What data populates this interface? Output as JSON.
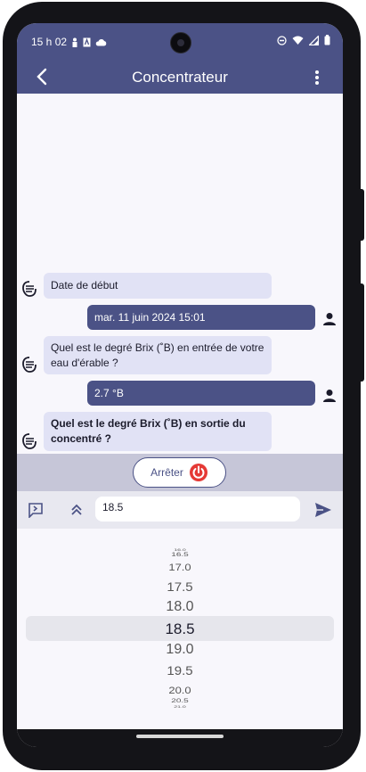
{
  "status_bar": {
    "time": "15 h 02"
  },
  "app_bar": {
    "title": "Concentrateur"
  },
  "messages": [
    {
      "from": "bot",
      "text": "Date de début"
    },
    {
      "from": "user",
      "text": "mar. 11 juin 2024 15:01"
    },
    {
      "from": "bot",
      "text": "Quel est le degré Brix (˚B) en entrée de votre eau d'érable ?"
    },
    {
      "from": "user",
      "text": "2.7 °B"
    },
    {
      "from": "bot",
      "text": "Quel est le degré Brix (˚B) en sortie du concentré ?"
    }
  ],
  "stop_button": {
    "label": "Arrêter"
  },
  "input": {
    "value": "18.5"
  },
  "picker": {
    "selected": "18.5",
    "items": [
      "16.0",
      "16.5",
      "17.0",
      "17.5",
      "18.0",
      "18.5",
      "19.0",
      "19.5",
      "20.0",
      "20.5",
      "21.0"
    ]
  },
  "colors": {
    "primary": "#4b5286",
    "bot_bubble": "#e1e2f5",
    "stop_accent": "#e53935"
  }
}
